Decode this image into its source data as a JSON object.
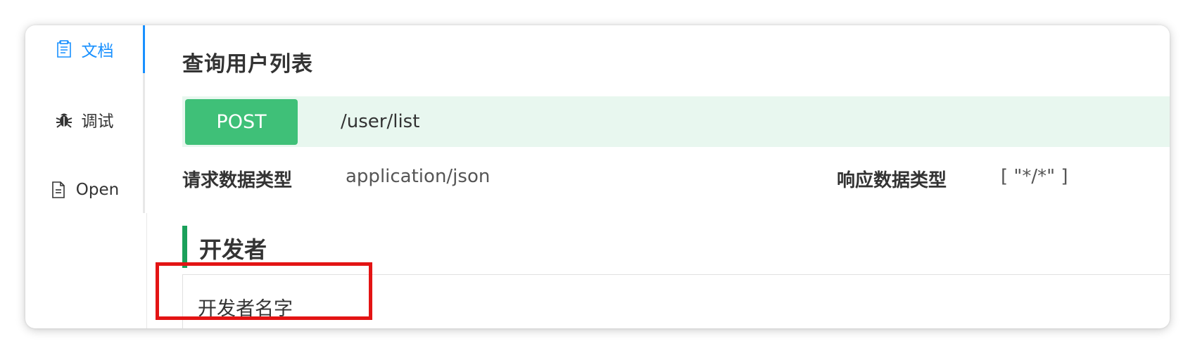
{
  "sidebar": {
    "items": [
      {
        "label": "文档",
        "icon": "document-icon",
        "active": true
      },
      {
        "label": "调试",
        "icon": "bug-icon",
        "active": false
      },
      {
        "label": "Open",
        "icon": "file-icon",
        "active": false
      }
    ],
    "accent_color": "#1890ff"
  },
  "main": {
    "title": "查询用户列表",
    "endpoint": {
      "method": "POST",
      "path": "/user/list",
      "method_color": "#3fc078",
      "bar_color": "#e8f7ef"
    },
    "request": {
      "label": "请求数据类型",
      "value": "application/json"
    },
    "response": {
      "label": "响应数据类型",
      "value": "[ \"*/*\" ]"
    },
    "section": {
      "title": "开发者",
      "accent_color": "#1aa05a",
      "field_label": "开发者名字"
    }
  },
  "annotation": {
    "highlight_color": "#e31414"
  }
}
